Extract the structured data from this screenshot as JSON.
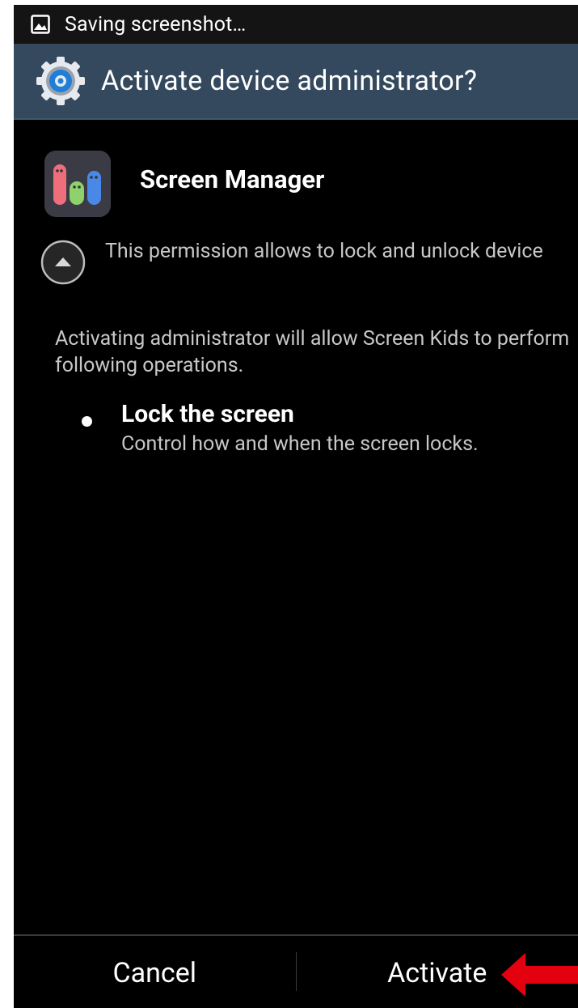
{
  "status_bar": {
    "notification_text": "Saving screenshot…",
    "icon": "image-icon"
  },
  "dialog": {
    "title": "Activate device administrator?",
    "title_icon": "gear-icon"
  },
  "app": {
    "name": "Screen Manager",
    "icon": "app-icon"
  },
  "permission": {
    "text": "This permission allows to lock and unlock device",
    "toggle_icon": "chevron-up-icon"
  },
  "info": {
    "text": "Activating administrator will allow Screen Kids to perform following operations."
  },
  "operations": [
    {
      "title": "Lock the screen",
      "description": "Control how and when the screen locks."
    }
  ],
  "buttons": {
    "cancel_label": "Cancel",
    "activate_label": "Activate"
  },
  "colors": {
    "title_bar": "#34495e",
    "background": "#000000",
    "annotation_arrow": "#e3000f"
  }
}
